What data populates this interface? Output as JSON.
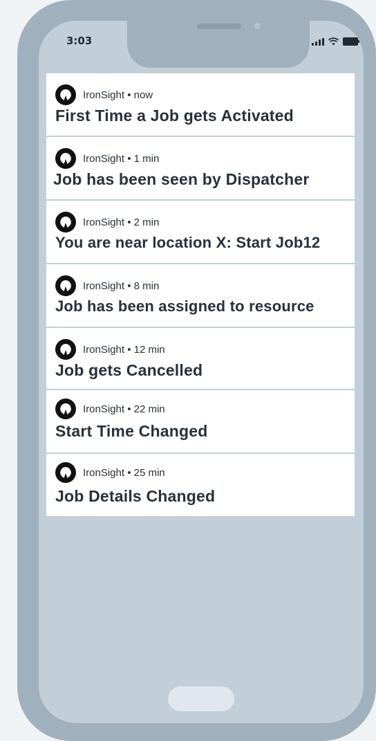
{
  "status_bar": {
    "time": "3:03",
    "icons": [
      "signal-icon",
      "wifi-icon",
      "battery-icon"
    ]
  },
  "notifications": [
    {
      "app": "IronSight",
      "age": "now",
      "meta": "IronSight • now",
      "title": "First Time a Job gets Activated"
    },
    {
      "app": "IronSight",
      "age": "1 min",
      "meta": "IronSight • 1 min",
      "title": "Job has been seen by Dispatcher"
    },
    {
      "app": "IronSight",
      "age": "2 min",
      "meta": "IronSight • 2 min",
      "title": "You are near location X: Start Job12"
    },
    {
      "app": "IronSight",
      "age": "8 min",
      "meta": "IronSight • 8 min",
      "title": "Job has been assigned to resource"
    },
    {
      "app": "IronSight",
      "age": "12 min",
      "meta": "IronSight • 12 min",
      "title": "Job gets Cancelled"
    },
    {
      "app": "IronSight",
      "age": "22 min",
      "meta": "IronSight • 22 min",
      "title": "Start Time Changed"
    },
    {
      "app": "IronSight",
      "age": "25 min",
      "meta": "IronSight • 25 min",
      "title": "Job Details Changed"
    }
  ],
  "colors": {
    "phone_frame": "#a1b0bd",
    "screen_bg": "#c2cfd9",
    "card_bg": "#ffffff",
    "title_text": "#2a3039",
    "page_bg": "#eff3f6"
  }
}
